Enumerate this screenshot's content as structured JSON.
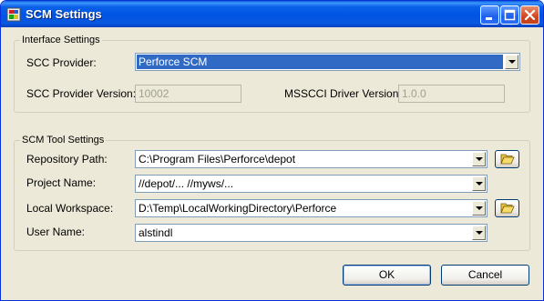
{
  "window": {
    "title": "SCM Settings"
  },
  "interface_settings": {
    "legend": "Interface Settings",
    "scc_provider_label": "SCC Provider:",
    "scc_provider_value": "Perforce SCM",
    "scc_provider_version_label": "SCC Provider Version:",
    "scc_provider_version_value": "10002",
    "msscci_driver_version_label": "MSSCCI Driver Version:",
    "msscci_driver_version_value": "1.0.0"
  },
  "scm_tool_settings": {
    "legend": "SCM Tool Settings",
    "repository_path_label": "Repository Path:",
    "repository_path_value": "C:\\Program Files\\Perforce\\depot",
    "project_name_label": "Project Name:",
    "project_name_value": "//depot/... //myws/...",
    "local_workspace_label": "Local Workspace:",
    "local_workspace_value": "D:\\Temp\\LocalWorkingDirectory\\Perforce",
    "user_name_label": "User Name:",
    "user_name_value": "alstindl"
  },
  "buttons": {
    "ok": "OK",
    "cancel": "Cancel"
  },
  "icons": {
    "app": "scm-app-icon",
    "minimize": "minimize-icon",
    "maximize": "maximize-icon",
    "close": "close-icon",
    "browse": "open-folder-icon"
  },
  "colors": {
    "titlebar": "#0054e3",
    "selection": "#316ac5",
    "dialog": "#ece9d8"
  }
}
